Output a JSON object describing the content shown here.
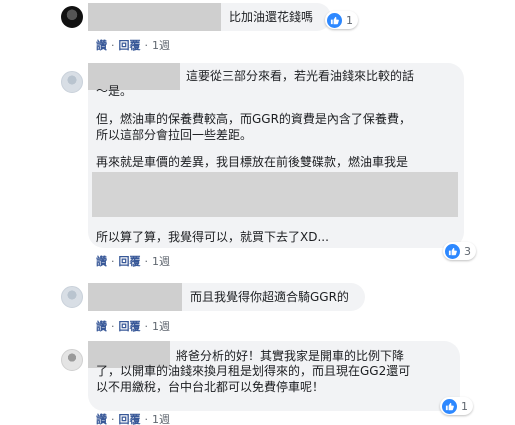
{
  "comments": [
    {
      "text": "比加油還花錢嗎",
      "like_count": "1",
      "actions": {
        "like": "讚",
        "reply": "回覆",
        "time": "1週"
      }
    },
    {
      "lines": [
        "這要從三部分來看，若光看油錢來比較的話",
        "～是。",
        "但，燃油車的保養費較高，而GGR的資費是內含了保養費，",
        "所以這部分會拉回一些差距。",
        "再來就是車價的差異，我目標放在前後雙碟款，燃油車我是",
        "所以算了算，我覺得可以，就買下去了XD..."
      ],
      "like_count": "3",
      "actions": {
        "like": "讚",
        "reply": "回覆",
        "time": "1週"
      }
    },
    {
      "text": "而且我覺得你超適合騎GGR的",
      "actions": {
        "like": "讚",
        "reply": "回覆",
        "time": "1週"
      }
    },
    {
      "lines": [
        "將爸分析的好！其實我家是開車的比例下降",
        "了，以開車的油錢來換月租是划得來的，而且現在GG2還可",
        "以不用繳稅，台中台北都可以免費停車呢！"
      ],
      "like_count": "1",
      "actions": {
        "like": "讚",
        "reply": "回覆",
        "time": "1週"
      }
    }
  ],
  "colors": {
    "link": "#385898",
    "like_blue": "#2d88ff",
    "bubble": "#f2f3f5"
  }
}
